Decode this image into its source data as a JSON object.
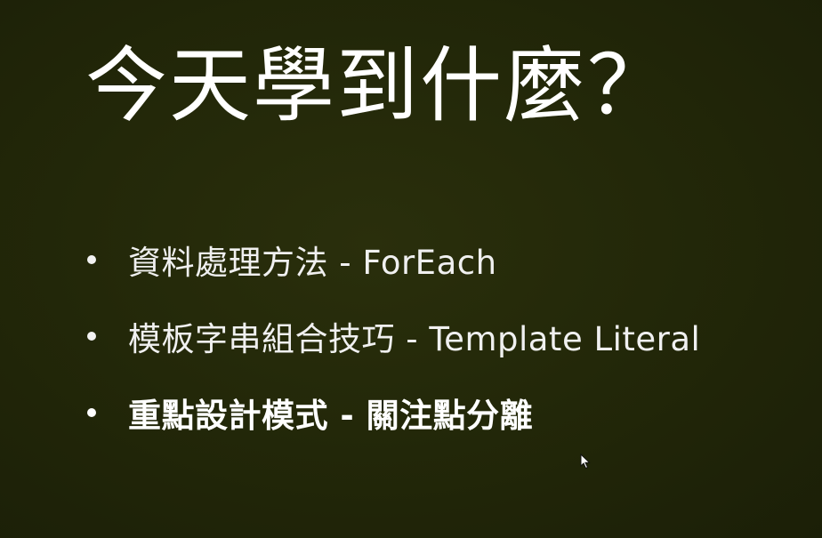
{
  "slide": {
    "title": "今天學到什麼？",
    "bullets": [
      {
        "text": "資料處理方法 - ForEach",
        "emphasis": false
      },
      {
        "text": "模板字串組合技巧 - Template Literal",
        "emphasis": false
      },
      {
        "text": "重點設計模式 - 關注點分離",
        "emphasis": true
      }
    ]
  },
  "colors": {
    "background": "#232809",
    "text": "#f0f0f0"
  },
  "icons": {
    "cursor": "mouse-pointer-icon"
  }
}
